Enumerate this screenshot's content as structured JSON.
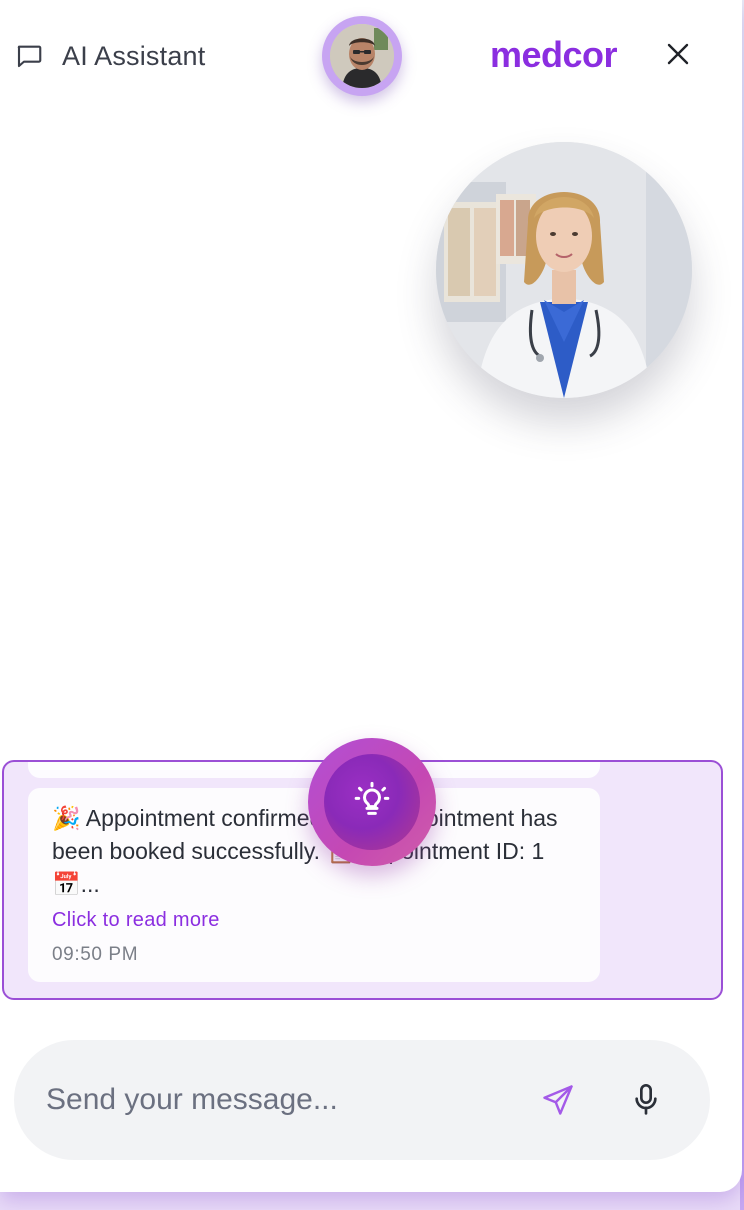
{
  "header": {
    "title": "AI Assistant",
    "brand": "medcor",
    "brand_color": "#8b2ee0"
  },
  "icons": {
    "chat": "message-square-icon",
    "close": "close-icon",
    "idea": "lightbulb-icon",
    "send": "send-icon",
    "mic": "microphone-icon"
  },
  "chat": {
    "message": {
      "text": "🎉 Appointment confirmed! Your appointment has been booked successfully. 📋 Appointment ID: 1 📅...",
      "read_more": "Click to read more",
      "time": "09:50 PM"
    }
  },
  "composer": {
    "placeholder": "Send your message..."
  }
}
